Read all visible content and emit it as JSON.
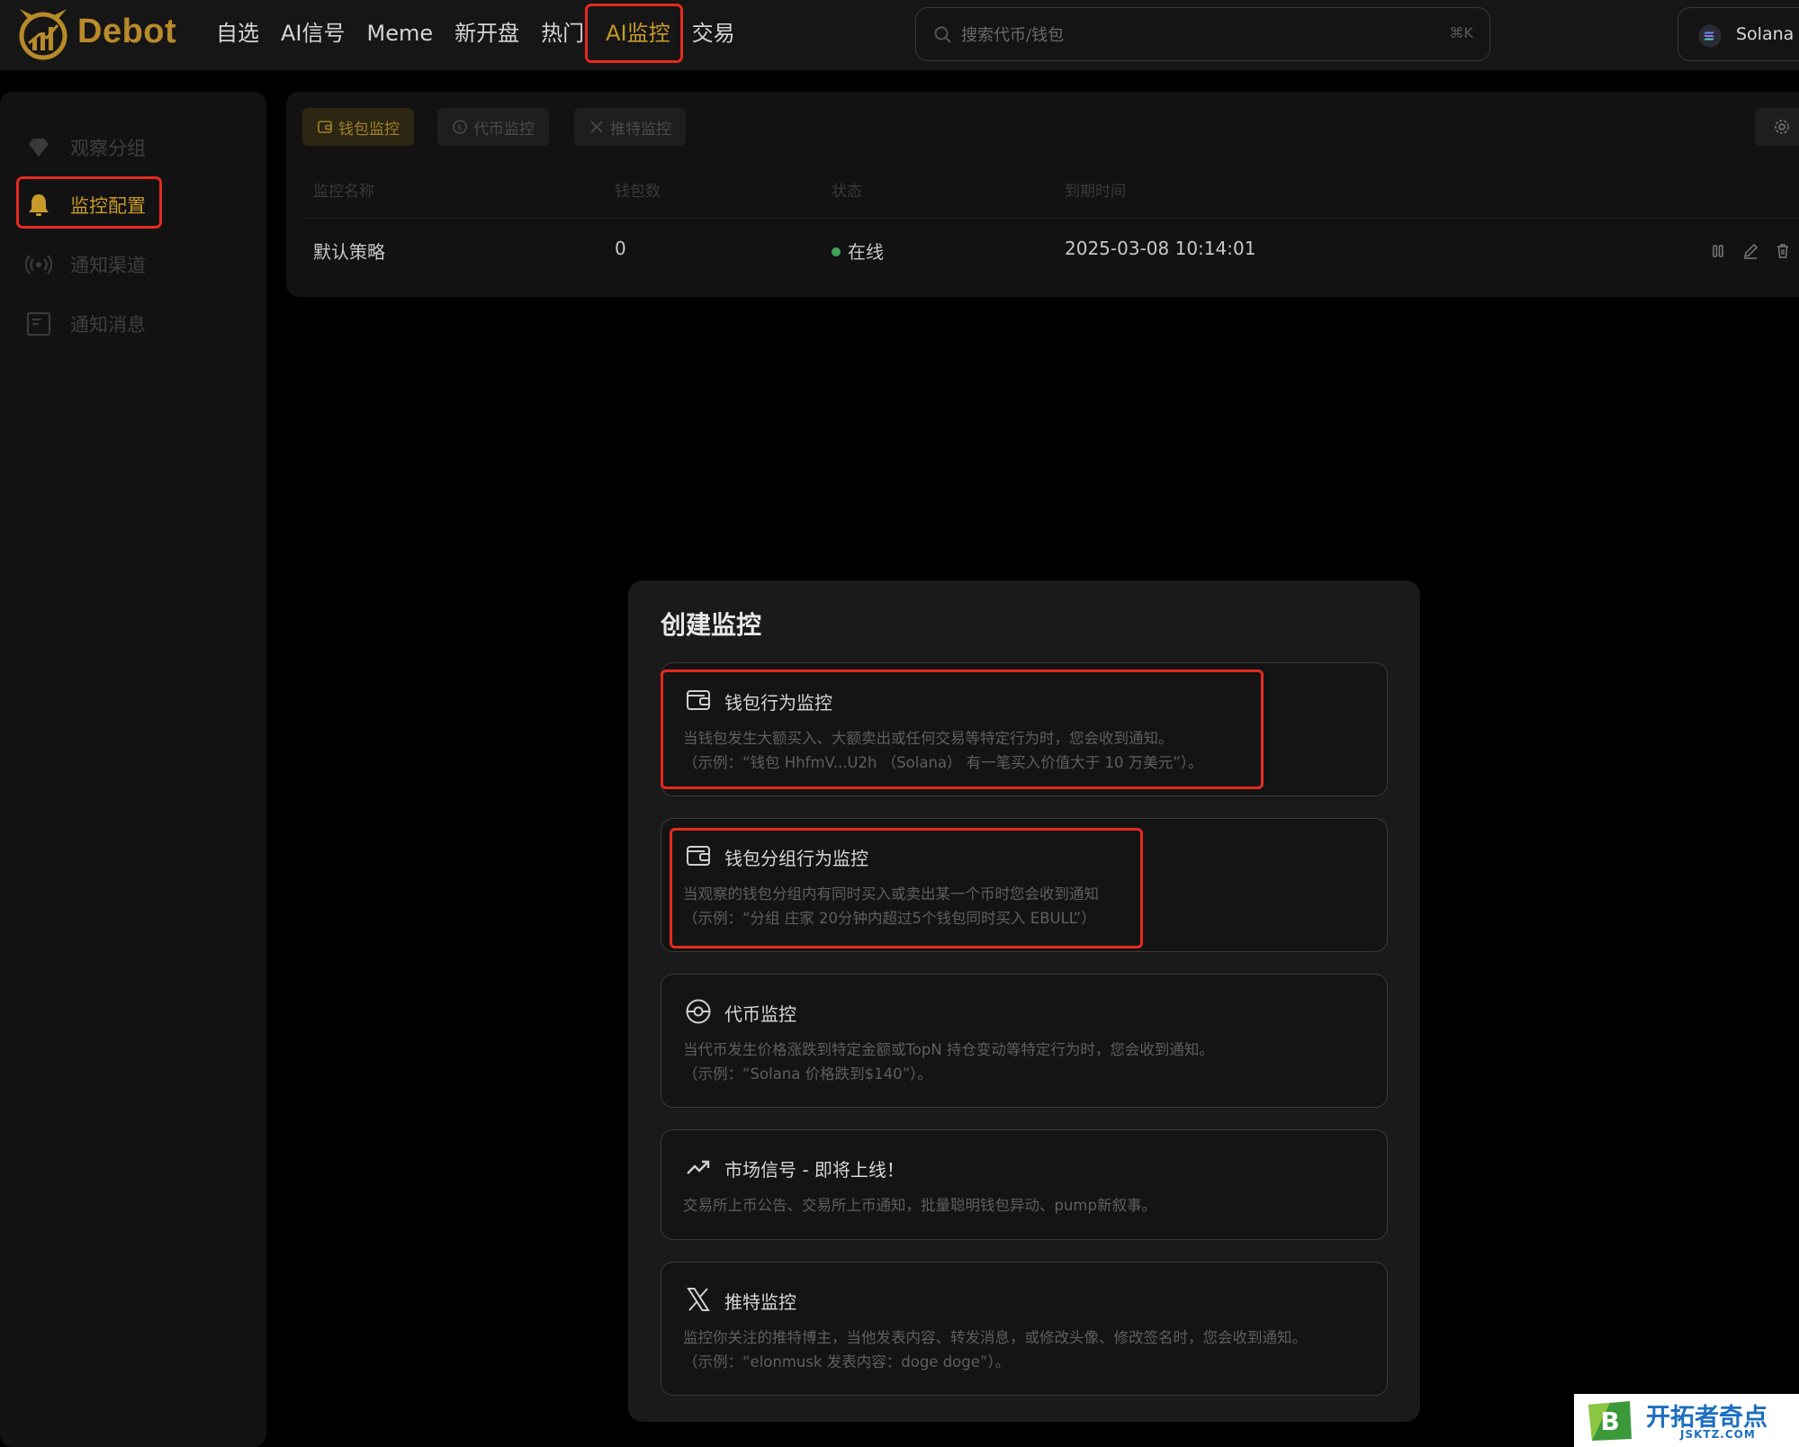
{
  "app": {
    "logo_text": "Debot"
  },
  "nav": {
    "items": [
      {
        "label": "自选",
        "active": false
      },
      {
        "label": "AI信号",
        "active": false
      },
      {
        "label": "Meme",
        "active": false
      },
      {
        "label": "新开盘",
        "active": false
      },
      {
        "label": "热门",
        "active": false
      },
      {
        "label": "AI监控",
        "active": true
      },
      {
        "label": "交易",
        "active": false
      }
    ]
  },
  "search": {
    "placeholder": "搜索代币/钱包",
    "shortcut": "⌘K"
  },
  "chain": {
    "label": "Solana"
  },
  "sidebar": {
    "items": [
      {
        "label": "观察分组",
        "icon": "diamond-icon"
      },
      {
        "label": "监控配置",
        "icon": "bell-icon",
        "active": true
      },
      {
        "label": "通知渠道",
        "icon": "broadcast-icon"
      },
      {
        "label": "通知消息",
        "icon": "message-list-icon"
      }
    ]
  },
  "tabs": [
    {
      "label": "钱包监控",
      "icon": "wallet-icon",
      "active": true
    },
    {
      "label": "代币监控",
      "icon": "coin-icon",
      "active": false
    },
    {
      "label": "推特监控",
      "icon": "x-logo-icon",
      "active": false
    }
  ],
  "table": {
    "headers": [
      "监控名称",
      "钱包数",
      "状态",
      "到期时间"
    ],
    "rows": [
      {
        "name": "默认策略",
        "wallets": "0",
        "status": "在线",
        "expires": "2025-03-08 10:14:01"
      }
    ]
  },
  "modal": {
    "title": "创建监控",
    "cards": [
      {
        "title": "钱包行为监控",
        "icon": "wallet-icon",
        "desc1": "当钱包发生大额买入、大额卖出或任何交易等特定行为时，您会收到通知。",
        "desc2": "（示例：“钱包 HhfmV...U2h （Solana） 有一笔买入价值大于 10 万美元”）。"
      },
      {
        "title": "钱包分组行为监控",
        "icon": "wallet-icon",
        "desc1": "当观察的钱包分组内有同时买入或卖出某一个币时您会收到通知",
        "desc2": "（示例：“分组 庄家 20分钟内超过5个钱包同时买入 EBULL”）"
      },
      {
        "title": "代币监控",
        "icon": "coin-icon",
        "desc1": "当代币发生价格涨跌到特定金额或TopN 持仓变动等特定行为时，您会收到通知。",
        "desc2": "（示例：“Solana 价格跌到$140”）。"
      },
      {
        "title": "市场信号 - 即将上线！",
        "icon": "trending-up-icon",
        "desc1": "交易所上币公告、交易所上币通知，批量聪明钱包异动、pump新叙事。",
        "desc2": ""
      },
      {
        "title": "推特监控",
        "icon": "x-logo-icon",
        "desc1": "监控你关注的推特博主，当他发表内容、转发消息，或修改头像、修改签名时，您会收到通知。",
        "desc2": "（示例：“elonmusk 发表内容：doge doge”）。"
      }
    ]
  },
  "watermark": {
    "text": "开拓者奇点",
    "sub": "JSKTZ.COM"
  },
  "colors": {
    "accent": "#c79a2a",
    "highlight": "#e52a1e",
    "online": "#3fa65a"
  }
}
